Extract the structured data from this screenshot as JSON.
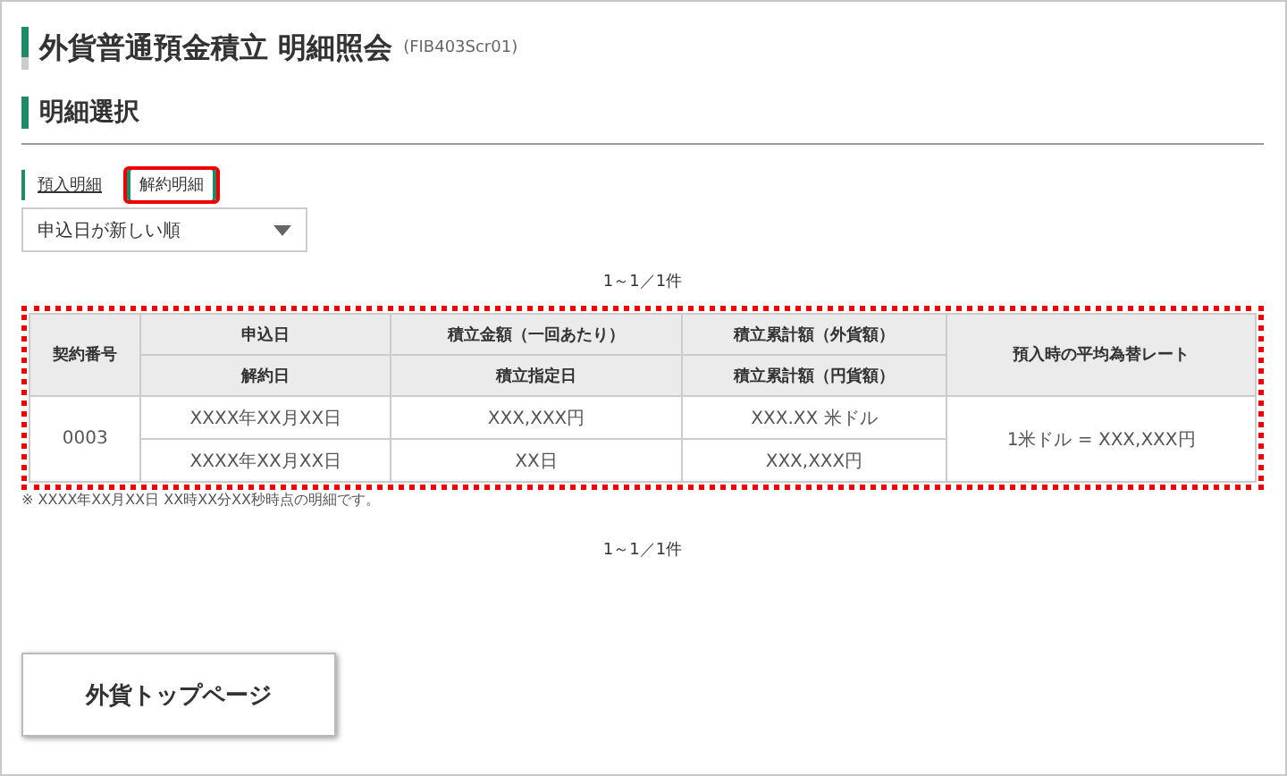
{
  "title": "外貨普通預金積立 明細照会",
  "screen_id": "(FIB403Scr01)",
  "section_heading": "明細選択",
  "tabs": [
    {
      "label": "預入明細",
      "selected": false
    },
    {
      "label": "解約明細",
      "selected": true
    }
  ],
  "sort_select": {
    "value": "申込日が新しい順"
  },
  "count_top": "1～1／1件",
  "table": {
    "highlighted": true,
    "columns": [
      {
        "lines": [
          "契約番号"
        ]
      },
      {
        "lines": [
          "申込日",
          "解約日"
        ]
      },
      {
        "lines": [
          "積立金額（一回あたり）",
          "積立指定日"
        ]
      },
      {
        "lines": [
          "積立累計額（外貨額）",
          "積立累計額（円貨額）"
        ]
      },
      {
        "lines": [
          "預入時の平均為替レート"
        ]
      }
    ],
    "rows": [
      {
        "cells": [
          {
            "lines": [
              "0003"
            ]
          },
          {
            "lines": [
              "XXXX年XX月XX日",
              "XXXX年XX月XX日"
            ]
          },
          {
            "lines": [
              "XXX,XXX円",
              "XX日"
            ]
          },
          {
            "lines": [
              "XXX.XX 米ドル",
              "XXX,XXX円"
            ]
          },
          {
            "lines": [
              "1米ドル = XXX,XXX円"
            ]
          }
        ]
      }
    ]
  },
  "footnote": "※ XXXX年XX月XX日 XX時XX分XX秒時点の明細です。",
  "count_bottom": "1～1／1件",
  "back_button": "外貨トップページ"
}
